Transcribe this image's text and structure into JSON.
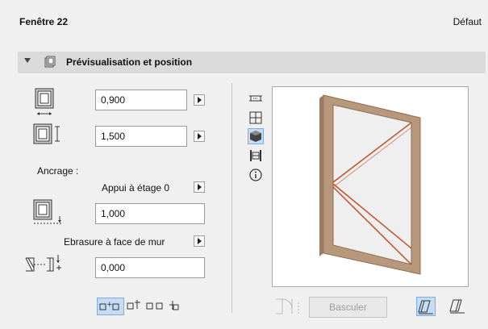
{
  "header": {
    "title": "Fenêtre 22",
    "default_label": "Défaut"
  },
  "section": {
    "title": "Prévisualisation et position",
    "expanded": true
  },
  "dimensions": {
    "width_value": "0,900",
    "height_value": "1,500"
  },
  "anchor": {
    "label": "Ancrage :",
    "reference": "Appui à étage 0",
    "elevation_value": "1,000"
  },
  "reveal": {
    "label": "Ebrasure à face de mur",
    "value": "0,000"
  },
  "preview": {
    "view_icons": [
      "plan-icon",
      "grid-icon",
      "3d-box-icon",
      "section-icon",
      "info-icon"
    ],
    "selected_view": "3d-box-icon",
    "frame_color": "#b8987a",
    "opening_line_color": "#c0502a"
  },
  "bottom": {
    "flip_button": "Basculer",
    "flip_enabled": false
  },
  "colors": {
    "selected_bg": "#c6dcf5",
    "selected_border": "#7eaee0"
  }
}
